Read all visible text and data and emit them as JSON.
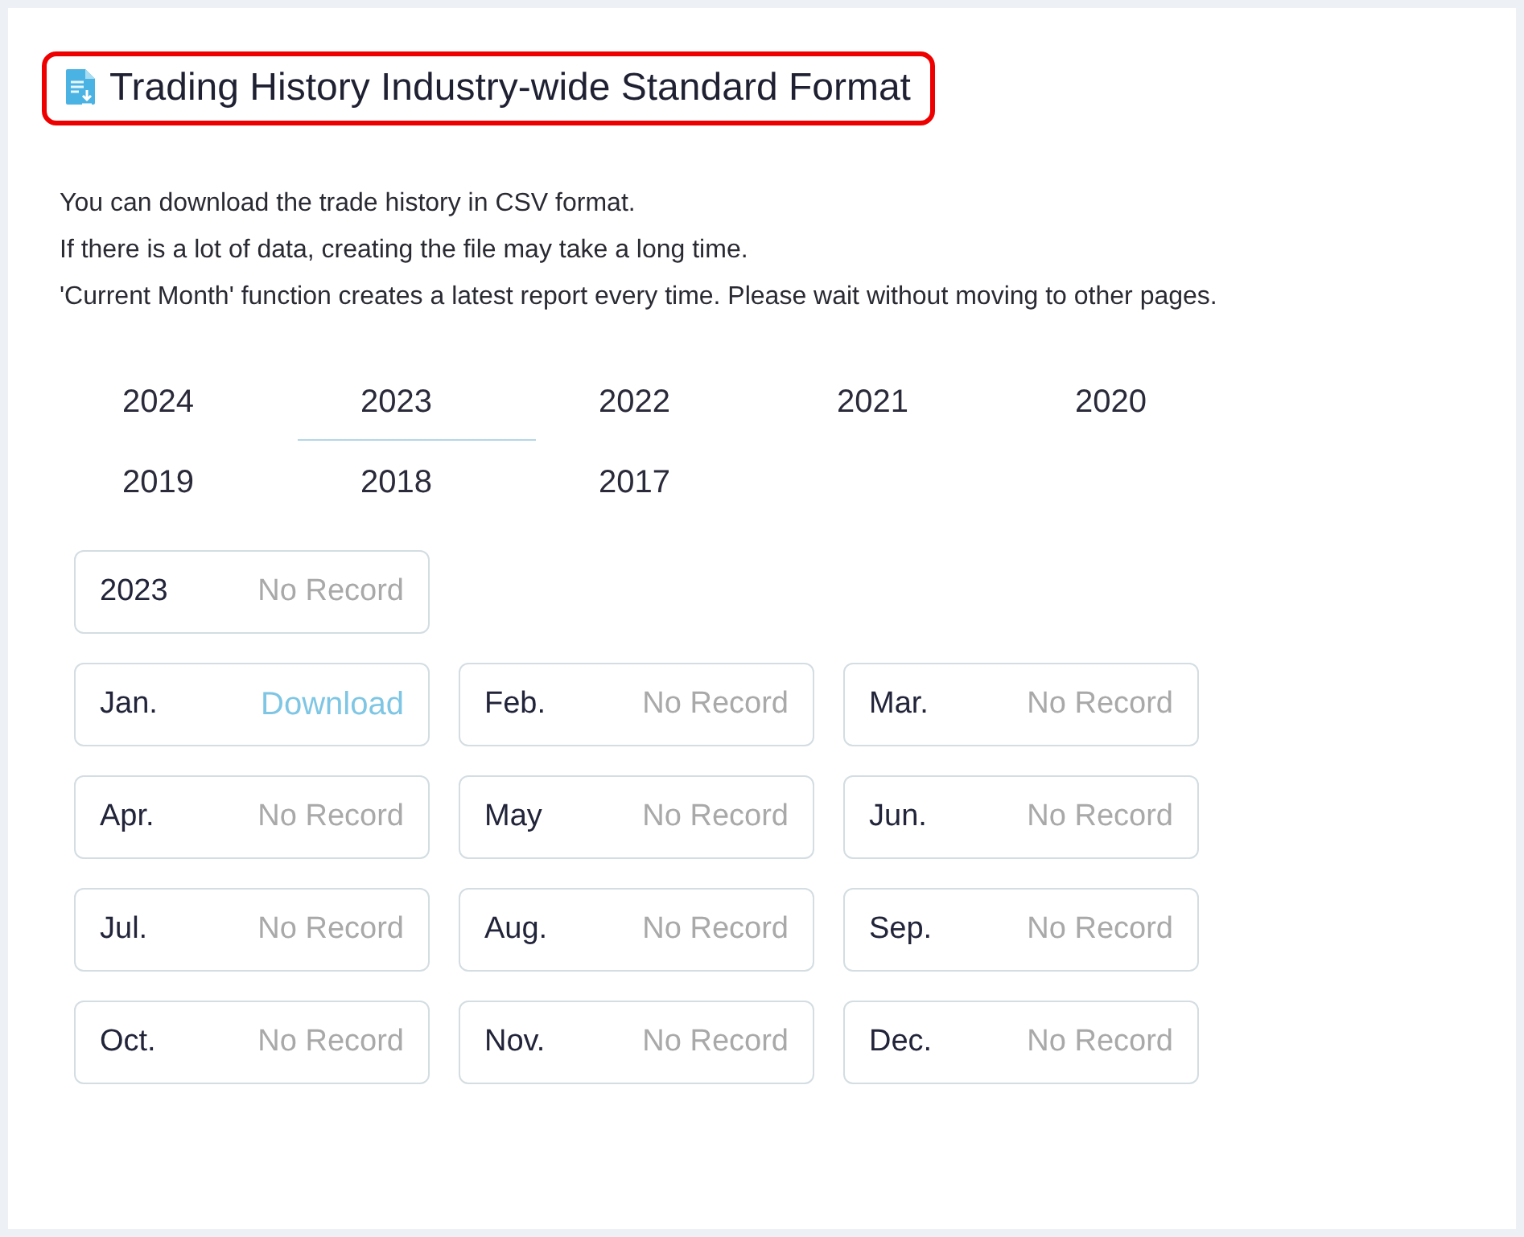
{
  "title": "Trading History Industry-wide Standard Format",
  "description": [
    "You can download the trade history in CSV format.",
    "If there is a lot of data, creating the file may take a long time.",
    "'Current Month' function creates a latest report every time. Please wait without moving to other pages."
  ],
  "year_tabs": [
    {
      "label": "2024",
      "selected": false
    },
    {
      "label": "2023",
      "selected": true
    },
    {
      "label": "2022",
      "selected": false
    },
    {
      "label": "2021",
      "selected": false
    },
    {
      "label": "2020",
      "selected": false
    },
    {
      "label": "2019",
      "selected": false
    },
    {
      "label": "2018",
      "selected": false
    },
    {
      "label": "2017",
      "selected": false
    }
  ],
  "year_card": {
    "label": "2023",
    "status": "No Record",
    "kind": "none"
  },
  "months": [
    {
      "label": "Jan.",
      "status": "Download",
      "kind": "download"
    },
    {
      "label": "Feb.",
      "status": "No Record",
      "kind": "none"
    },
    {
      "label": "Mar.",
      "status": "No Record",
      "kind": "none"
    },
    {
      "label": "Apr.",
      "status": "No Record",
      "kind": "none"
    },
    {
      "label": "May",
      "status": "No Record",
      "kind": "none"
    },
    {
      "label": "Jun.",
      "status": "No Record",
      "kind": "none"
    },
    {
      "label": "Jul.",
      "status": "No Record",
      "kind": "none"
    },
    {
      "label": "Aug.",
      "status": "No Record",
      "kind": "none"
    },
    {
      "label": "Sep.",
      "status": "No Record",
      "kind": "none"
    },
    {
      "label": "Oct.",
      "status": "No Record",
      "kind": "none"
    },
    {
      "label": "Nov.",
      "status": "No Record",
      "kind": "none"
    },
    {
      "label": "Dec.",
      "status": "No Record",
      "kind": "none"
    }
  ]
}
